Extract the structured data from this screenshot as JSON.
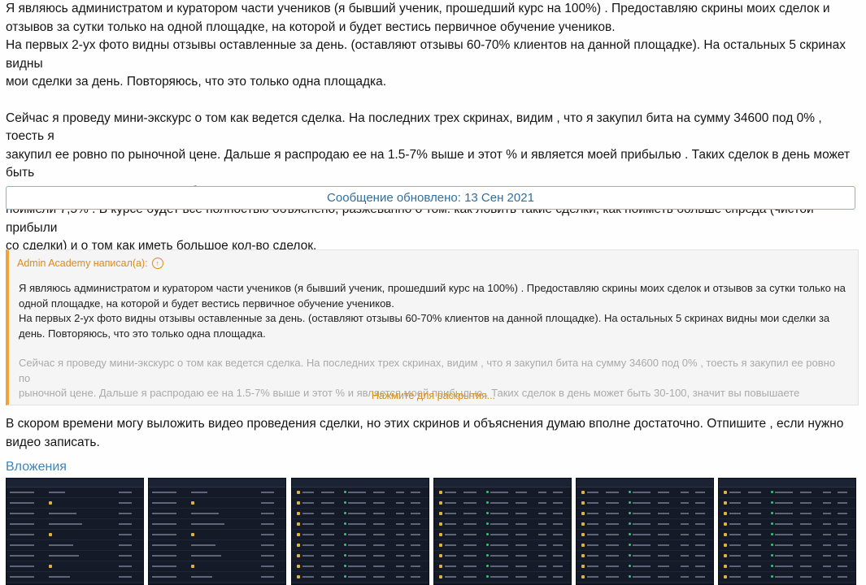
{
  "post": {
    "p1_line1": "Я являюсь администратом и куратором части учеников (я бывший ученик, прошедший курс на 100%) . Предоставляю скрины моих сделок и",
    "p1_line2": "отзывов за сутки только на одной площадке, на которой и будет вестись первичное обучение учеников.",
    "p2_line1": "На первых 2-ух фото видны отзывы оставленные за день. (оставляют отзывы 60-70% клиентов на данной площадке). На остальных 5 скринах видны",
    "p2_line2": "мои сделки за день. Повторяюсь, что это только одна площадка.",
    "p3_line1": "Сейчас я проведу мини-экскурс о том как ведется сделка. На последних трех скринах, видим , что я закупил бита на сумму 34600 под 0% , тоесть я",
    "p3_line2": "закупил ее ровно по рыночной цене. Дальше я распродаю ее на 1.5-7% выше и этот % и является моей прибылью . Таких сделок в день может быть",
    "p3_line3": "30-100, значит вы повышаете оборачиваемость денег за определенное время, тоесть допустим 50к вы провернули 5 раз по 1,5% и того вы",
    "p3_line4": "поимели 7,5% . В курсе будет всё полностью объяснено, разжеванно о том: как ловить такие сделки, как поиметь больше спреда (чистой прибыли",
    "p3_line5": "со сделки) и о том как иметь большое кол-во сделок."
  },
  "updated_notice": "Сообщение обновлено: 13 Сен 2021",
  "quote": {
    "author": "Admin Academy написал(а):",
    "line1": "Я являюсь администратом и куратором части учеников (я бывший ученик, прошедший курс на 100%) . Предоставляю скрины моих сделок и отзывов за сутки только на",
    "line2": "одной площадке, на которой и будет вестись первичное обучение учеников.",
    "line3": "На первых 2-ух фото видны отзывы оставленные за день. (оставляют отзывы 60-70% клиентов на данной площадке). На остальных 5 скринах видны мои сделки за",
    "line4": "день. Повторяюсь, что это только одна площадка.",
    "line5": "Сейчас я проведу мини-экскурс о том как ведется сделка. На последних трех скринах, видим , что я закупил бита на сумму 34600 под 0% , тоесть я закупил ее ровно по",
    "line6": "рыночной цене. Дальше я распродаю ее на 1.5-7% выше и этот % и является моей прибылью . Таких сделок в день может быть 30-100, значит вы повышаете",
    "expand_label": "Нажмите для раскрытия..."
  },
  "after": {
    "line1": "В скором времени могу выложить видео проведения сделки, но этих скринов и объяснения думаю вполне достаточно. Отпишите , если нужно",
    "line2": "видео записать."
  },
  "attachments": {
    "title": "Вложения",
    "items": [
      "attachment-1",
      "attachment-2",
      "attachment-3",
      "attachment-4",
      "attachment-5",
      "attachment-6"
    ]
  },
  "colors": {
    "quote_accent": "#f1a338",
    "link": "#3d86b8",
    "thumb_bg": "#141a27"
  }
}
